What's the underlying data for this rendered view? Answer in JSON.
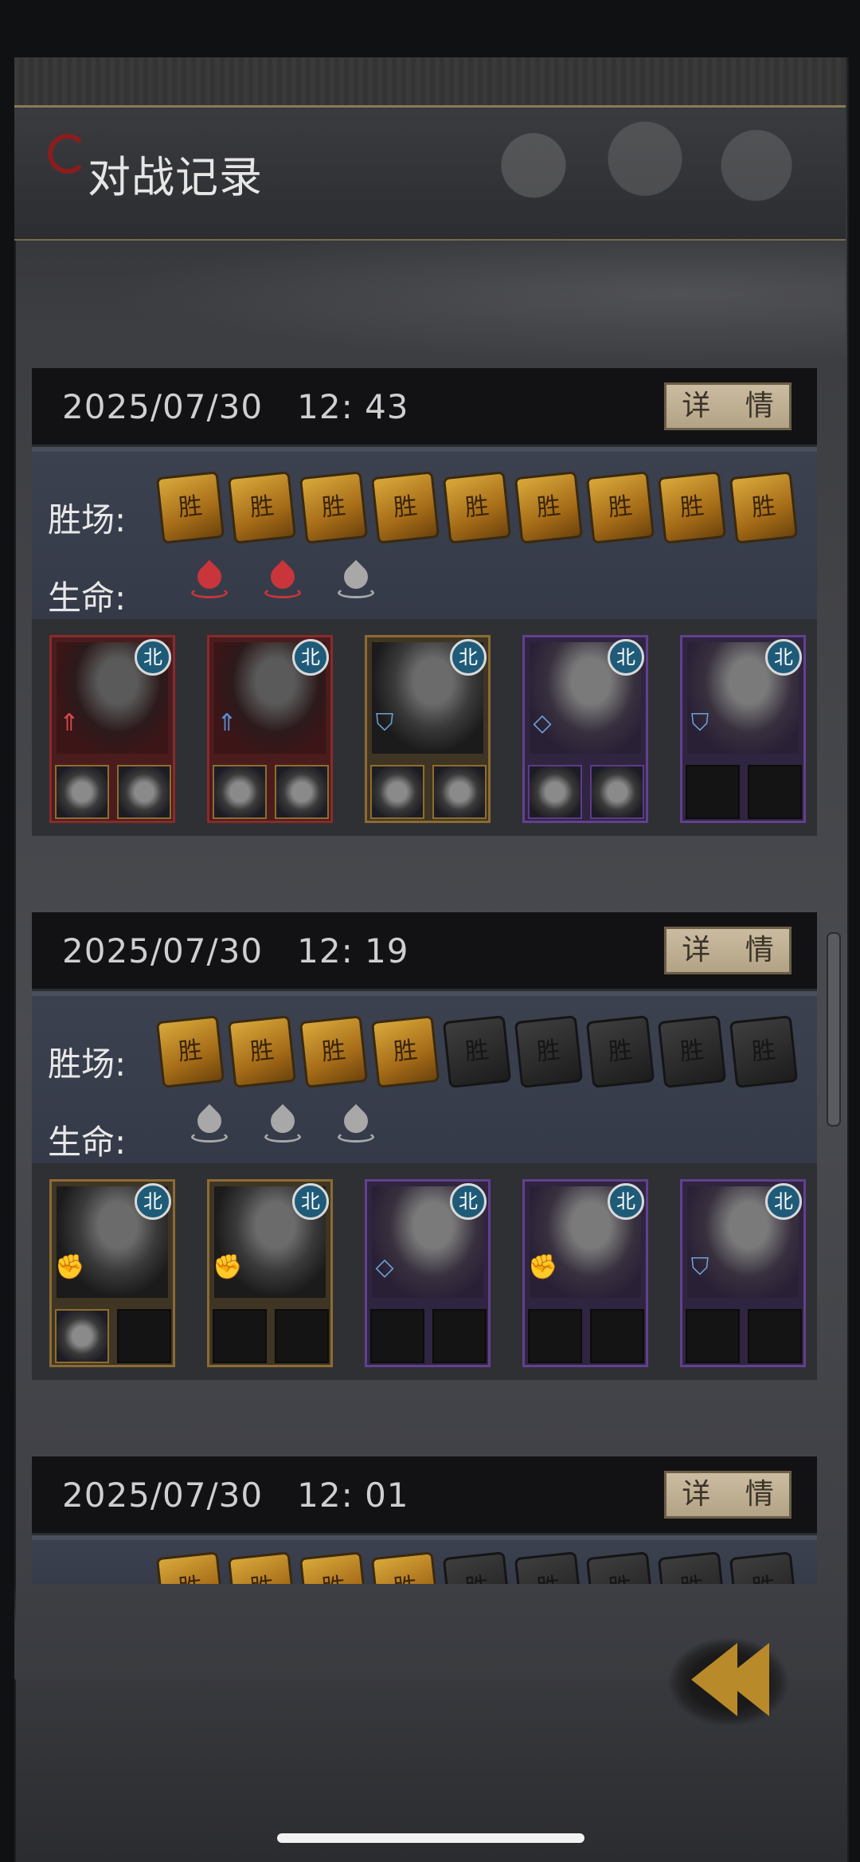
{
  "header": {
    "title": "对战记录"
  },
  "labels": {
    "wins": "胜场:",
    "life": "生命:",
    "detail": "详 情"
  },
  "win_token_char": "胜",
  "colors": {
    "life_active": "#c8353a",
    "life_lost": "#a8a8a8"
  },
  "records": [
    {
      "date": "2025/07/30",
      "time": "12: 43",
      "wins_earned": 9,
      "wins_total": 9,
      "lives_remaining": 2,
      "lives_total": 3,
      "heroes": [
        {
          "frame": "red",
          "badge": "北",
          "role_icon": "arrow-up-red-icon",
          "slots": [
            "bracelet",
            "ring"
          ]
        },
        {
          "frame": "red",
          "badge": "北",
          "role_icon": "arrow-up-blue-icon",
          "slots": [
            "pouch",
            "mask"
          ]
        },
        {
          "frame": "gold",
          "badge": "北",
          "role_icon": "shield-icon",
          "slots": [
            "gauntlet",
            "gauntlet"
          ]
        },
        {
          "frame": "purple",
          "badge": "北",
          "role_icon": "diamond-icon",
          "slots": [
            "pouch",
            "alpaca"
          ]
        },
        {
          "frame": "purple",
          "badge": "北",
          "role_icon": "shield-icon",
          "slots": [
            "",
            ""
          ]
        }
      ]
    },
    {
      "date": "2025/07/30",
      "time": "12: 19",
      "wins_earned": 4,
      "wins_total": 9,
      "lives_remaining": 0,
      "lives_total": 3,
      "heroes": [
        {
          "frame": "gold",
          "badge": "北",
          "role_icon": "fist-red-icon",
          "slots": [
            "armor",
            ""
          ]
        },
        {
          "frame": "gold",
          "badge": "北",
          "role_icon": "fist-blue-icon",
          "slots": [
            "",
            ""
          ]
        },
        {
          "frame": "purple",
          "badge": "北",
          "role_icon": "diamond-icon",
          "slots": [
            "",
            ""
          ]
        },
        {
          "frame": "purple",
          "badge": "北",
          "role_icon": "fist-red-icon",
          "slots": [
            "",
            ""
          ]
        },
        {
          "frame": "purple",
          "badge": "北",
          "role_icon": "shield-icon",
          "slots": [
            "",
            ""
          ]
        }
      ]
    },
    {
      "date": "2025/07/30",
      "time": "12: 01"
    }
  ]
}
